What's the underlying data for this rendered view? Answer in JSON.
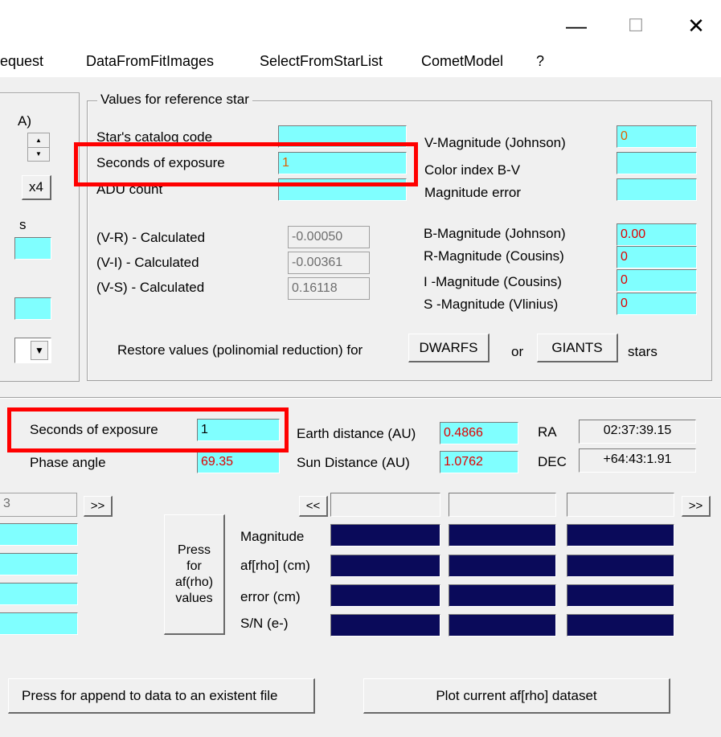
{
  "titlebar": {
    "minimize_symbol": "—",
    "maximize_symbol": "☐",
    "close_symbol": "✕"
  },
  "menu": {
    "items": [
      "equest",
      "DataFromFitImages",
      "SelectFromStarList",
      "CometModel",
      "?"
    ]
  },
  "left_panel": {
    "label_a": "A)",
    "x4_button": "x4",
    "label_s": "s",
    "combo_arrow": "▼",
    "spin_up": "▲",
    "spin_down": "▼"
  },
  "ref_star": {
    "group_title": "Values for reference star",
    "catalog_code_label": "Star's catalog code",
    "catalog_code_value": "",
    "exposure_label": "Seconds of exposure",
    "exposure_value": "1",
    "adu_label": "ADU count",
    "adu_value": "",
    "v_mag_label": "V-Magnitude (Johnson)",
    "v_mag_value": "0",
    "color_index_label": "Color index B-V",
    "color_index_value": "",
    "mag_error_label": "Magnitude error",
    "mag_error_value": "",
    "vr_label": "(V-R) - Calculated",
    "vr_value": "-0.00050",
    "vi_label": "(V-I) -  Calculated",
    "vi_value": "-0.00361",
    "vs_label": "(V-S) - Calculated",
    "vs_value": "0.16118",
    "b_mag_label": "B-Magnitude (Johnson)",
    "b_mag_value": "0.00",
    "r_mag_label": "R-Magnitude (Cousins)",
    "r_mag_value": "0",
    "i_mag_label": "I -Magnitude (Cousins)",
    "i_mag_value": "0",
    "s_mag_label": "S -Magnitude (Vlinius)",
    "s_mag_value": "0",
    "restore_label": "Restore values (polinomial reduction) for",
    "dwarfs_button": "DWARFS",
    "or_label": "or",
    "giants_button": "GIANTS",
    "stars_label": "stars"
  },
  "comet": {
    "exposure_label": "Seconds of exposure",
    "exposure_value": "1",
    "phase_label": "Phase angle",
    "phase_value": "69.35",
    "earth_dist_label": "Earth distance (AU)",
    "earth_dist_value": "0.4866",
    "sun_dist_label": "Sun Distance (AU)",
    "sun_dist_value": "1.0762",
    "ra_label": "RA",
    "ra_value": "02:37:39.15",
    "dec_label": "DEC",
    "dec_value": "+64:43:1.91"
  },
  "results": {
    "left_field_value": "3",
    "next_button_left": ">>",
    "prev_button": "<<",
    "next_button": ">>",
    "press_button": "Press\nfor\naf(rho)\nvalues",
    "row_labels": [
      "Magnitude",
      "af[rho] (cm)",
      "error (cm)",
      "S/N (e-)"
    ]
  },
  "bottom": {
    "append_button": "Press for append to  data to an existent file",
    "plot_button": "Plot current af[rho] dataset"
  }
}
